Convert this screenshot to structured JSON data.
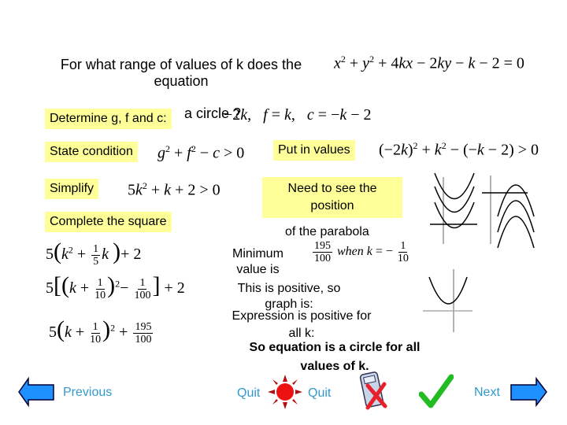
{
  "question": {
    "line1": "For what range of values of  k  does the",
    "line2": "equation",
    "line3_partial": "a circle ?",
    "equation": "x² + y² + 4kx − 2ky − k − 2 = 0"
  },
  "steps": {
    "determine_label": "Determine g, f and c:",
    "determine_values": "g = −2k,   f = k,   c = −k − 2",
    "state_label": "State condition",
    "state_math": "g² + f² − c > 0",
    "put_label": "Put in values",
    "put_math": "(−2k)² + k² − (−k − 2) > 0",
    "simplify_label": "Simplify",
    "simplify_math": "5k² + k + 2 > 0",
    "complete_label": "Complete the square",
    "complete_lines": [
      "5(k² + 1/5 k) + 2",
      "5[(k + 1/10)² − 1/100] + 2",
      "5(k + 1/10)² + 195/100"
    ],
    "need_label_line1": "Need to see the",
    "need_label_line2": "position",
    "parabola_text": "of the parabola",
    "minimum_line1": "Minimum",
    "minimum_line2": "value is",
    "minimum_math": "195/100 when k = −1/10",
    "positive_line1": "This is positive, so",
    "positive_line2": "graph is:",
    "expression_line1": "Expression is positive for",
    "expression_line2": "all k:",
    "conclusion_line1": "So equation is a circle for all",
    "conclusion_line2": "values of  k."
  },
  "fractions": {
    "one": "1",
    "five": "5",
    "ten": "10",
    "hundred": "100",
    "onehundredninetyfive": "195"
  },
  "nav": {
    "previous_label": "Previous",
    "quit_label_left": "Quit",
    "quit_label_right": "Quit",
    "next_label": "Next"
  },
  "colors": {
    "highlight": "#ffff99",
    "nav_text": "#3399cc",
    "arrow_fill": "#1e90ff",
    "quit_red": "#ee1111",
    "check_green": "#22bb22",
    "cross_red": "#e8202a"
  }
}
